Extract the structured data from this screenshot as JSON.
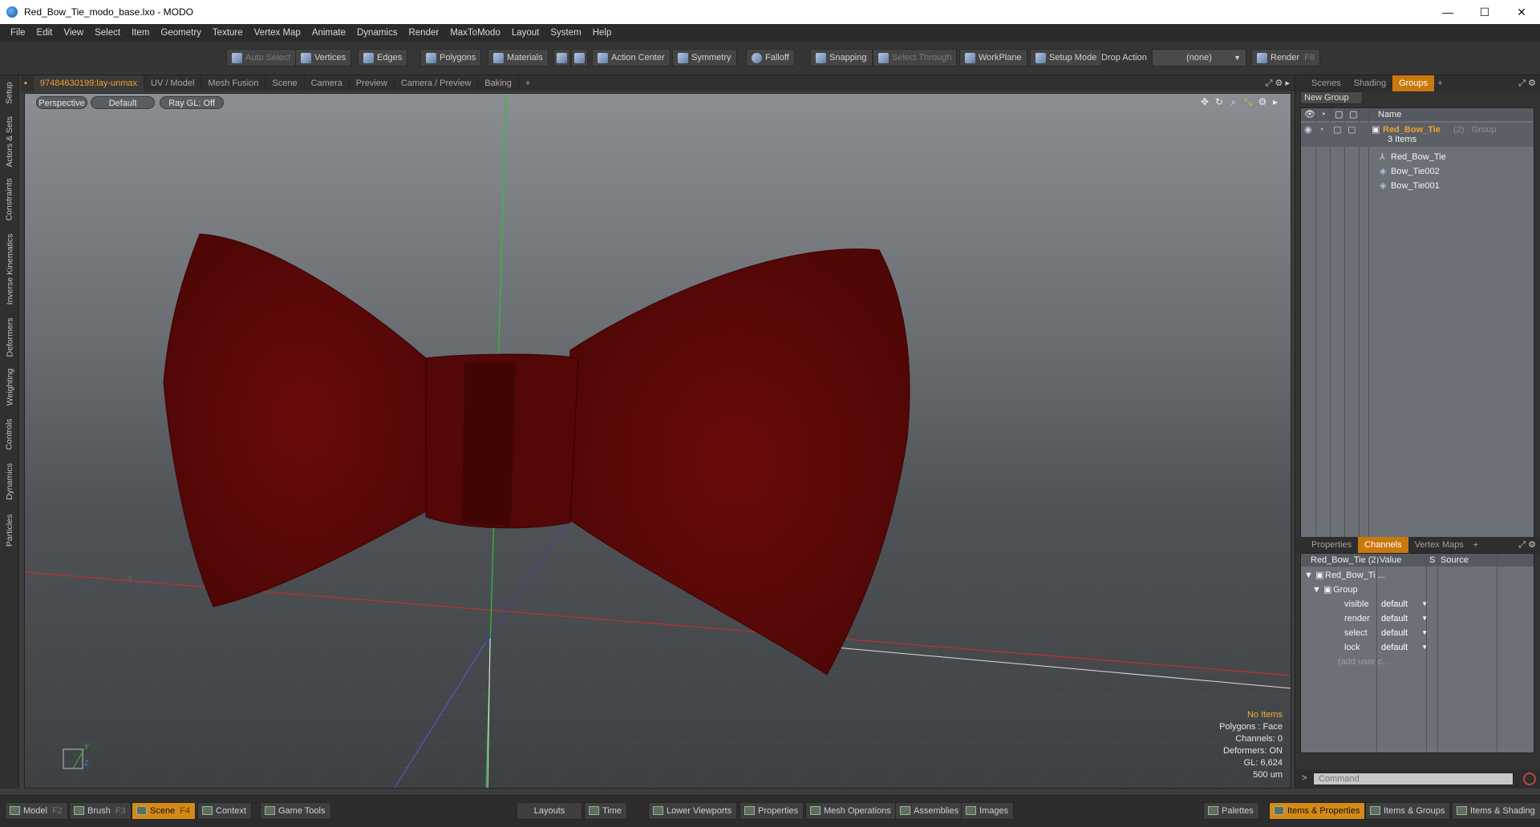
{
  "window": {
    "title": "Red_Bow_Tie_modo_base.lxo - MODO",
    "minimize": "—",
    "maximize": "☐",
    "close": "✕"
  },
  "menu": [
    "File",
    "Edit",
    "View",
    "Select",
    "Item",
    "Geometry",
    "Texture",
    "Vertex Map",
    "Animate",
    "Dynamics",
    "Render",
    "MaxToModo",
    "Layout",
    "System",
    "Help"
  ],
  "toolbar": {
    "auto_select": "Auto Select",
    "vertices": "Vertices",
    "edges": "Edges",
    "polygons": "Polygons",
    "materials": "Materials",
    "action_center": "Action Center",
    "symmetry": "Symmetry",
    "falloff": "Falloff",
    "snapping": "Snapping",
    "select_through": "Select Through",
    "workplane": "WorkPlane",
    "setup_mode": "Setup Mode",
    "drop_action_label": "Drop Action",
    "drop_action_value": "(none)",
    "render": "Render",
    "render_key": "F9"
  },
  "left_tabs": [
    "Setup",
    "Actors & Sets",
    "Constraints",
    "Inverse Kinematics",
    "Deformers",
    "Weighting",
    "Controls",
    "Dynamics",
    "Particles"
  ],
  "viewport_tabs": [
    "97484630199:lay-unmax",
    "UV / Model",
    "Mesh Fusion",
    "Scene",
    "Camera",
    "Preview",
    "Camera / Preview",
    "Baking",
    "+"
  ],
  "viewport": {
    "view_mode": "Perspective",
    "shading": "Default",
    "raygl": "Ray GL: Off",
    "info": {
      "items": "No Items",
      "polygons": "Polygons : Face",
      "channels": "Channels: 0",
      "deformers": "Deformers: ON",
      "gl": "GL: 6,624",
      "scale": "500 um"
    },
    "axis_y": "Y",
    "axis_z": "Z",
    "axis_x": "X"
  },
  "groups_panel": {
    "tabs": [
      "Scenes",
      "Shading",
      "Groups",
      "+"
    ],
    "active_tab": "Groups",
    "new_group": "New Group",
    "header_name": "Name",
    "root": {
      "name": "Red_Bow_Tie",
      "suffix": "(2) : Group",
      "count": "3 Items"
    },
    "children": [
      "Red_Bow_Tie",
      "Bow_Tie002",
      "Bow_Tie001"
    ]
  },
  "channels_panel": {
    "tabs": [
      "Properties",
      "Channels",
      "Vertex Maps",
      "+"
    ],
    "active_tab": "Channels",
    "header": {
      "name": "Red_Bow_Tie (2)",
      "value": "Value",
      "s": "S",
      "source": "Source"
    },
    "item": "Red_Bow_Ti ...",
    "group": "Group",
    "rows": [
      {
        "name": "visible",
        "value": "default"
      },
      {
        "name": "render",
        "value": "default"
      },
      {
        "name": "select",
        "value": "default"
      },
      {
        "name": "lock",
        "value": "default"
      }
    ],
    "add_user": "(add user c..."
  },
  "command": {
    "prompt": ">",
    "placeholder": "Command"
  },
  "bottombar": {
    "model": "Model",
    "model_key": "F2",
    "brush": "Brush",
    "brush_key": "F3",
    "scene": "Scene",
    "scene_key": "F4",
    "context": "Context",
    "game_tools": "Game Tools",
    "layouts": "Layouts",
    "time": "Time",
    "lower_viewports": "Lower Viewports",
    "properties": "Properties",
    "mesh_operations": "Mesh Operations",
    "assemblies": "Assemblies",
    "images": "Images",
    "palettes": "Palettes",
    "items_properties": "Items & Properties",
    "items_groups": "Items & Groups",
    "items_shading": "Items & Shading"
  },
  "colors": {
    "accent": "#d58a18",
    "bowtie": "#5e0808",
    "axis_x": "#c03030",
    "axis_y": "#30c030",
    "axis_z": "#3050c0"
  }
}
